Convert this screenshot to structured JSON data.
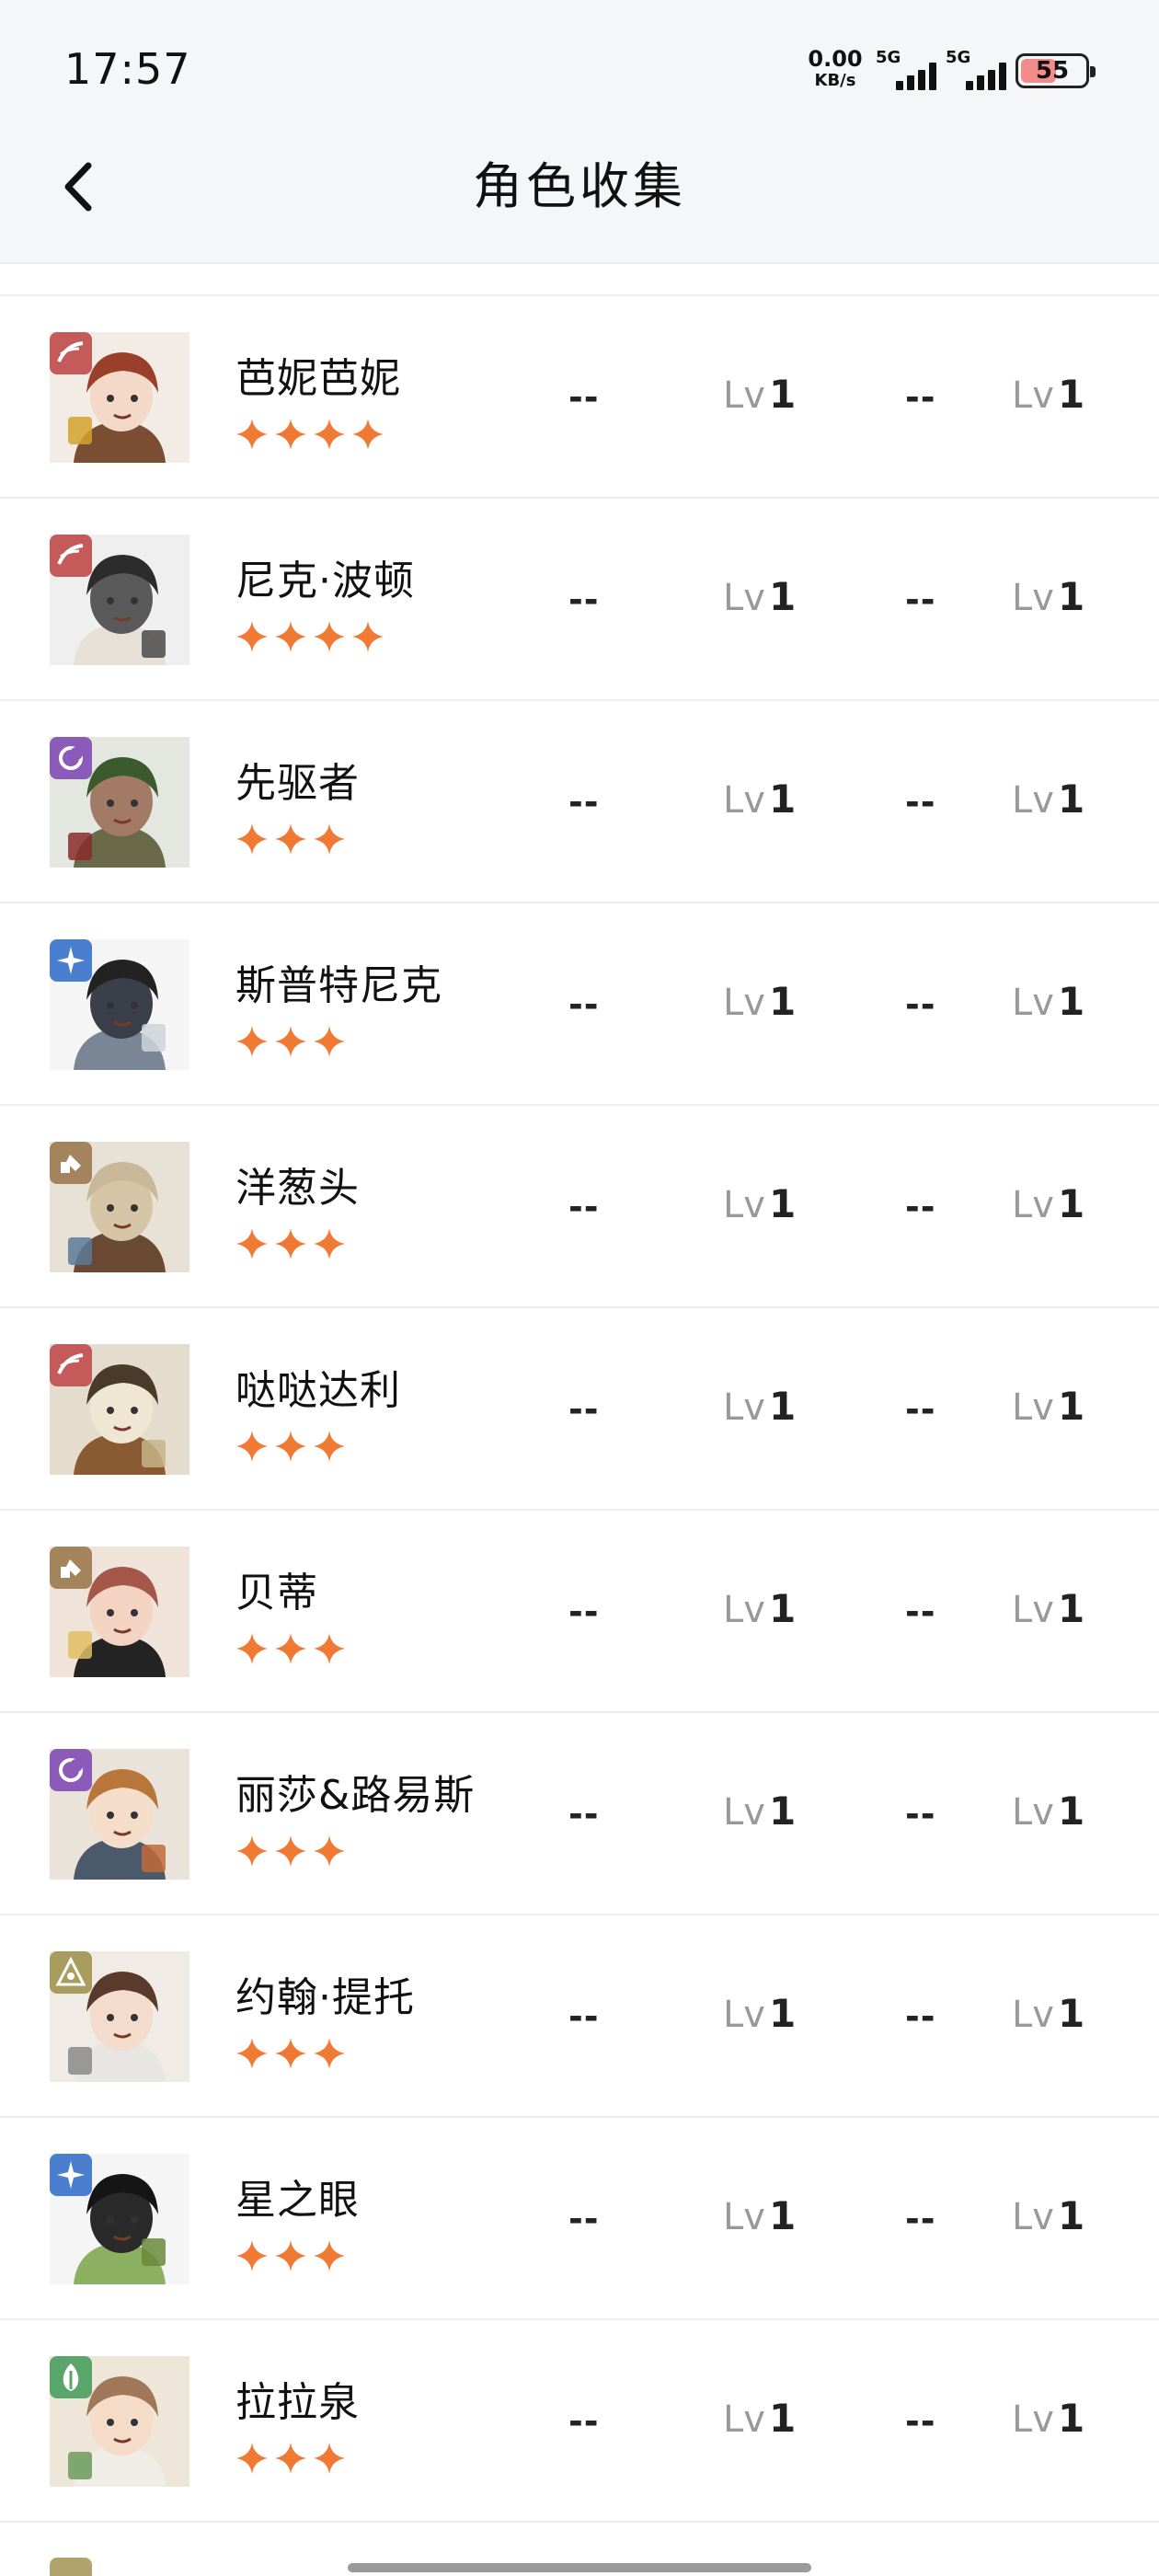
{
  "status_bar": {
    "time": "17:57",
    "net_speed_value": "0.00",
    "net_speed_unit": "KB/s",
    "signal1_label": "5G",
    "signal2_label": "5G",
    "battery": "55"
  },
  "header": {
    "title": "角色收集",
    "back_icon": "chevron-left-icon"
  },
  "colors": {
    "star": "#f07a33",
    "attr_red": "#c45a5a",
    "attr_purple": "#8a5bb8",
    "attr_blue": "#4a7fcf",
    "attr_tan": "#a4845c",
    "attr_olive": "#a89c5f",
    "attr_green": "#5aa66a"
  },
  "characters": [
    {
      "name": "芭妮芭妮",
      "rarity": 4,
      "badge": "red",
      "dash1": "--",
      "lv1_label": "Lv",
      "lv1_value": "1",
      "dash2": "--",
      "lv2_label": "Lv",
      "lv2_value": "1"
    },
    {
      "name": "尼克·波顿",
      "rarity": 4,
      "badge": "red",
      "dash1": "--",
      "lv1_label": "Lv",
      "lv1_value": "1",
      "dash2": "--",
      "lv2_label": "Lv",
      "lv2_value": "1"
    },
    {
      "name": "先驱者",
      "rarity": 3,
      "badge": "purple",
      "dash1": "--",
      "lv1_label": "Lv",
      "lv1_value": "1",
      "dash2": "--",
      "lv2_label": "Lv",
      "lv2_value": "1"
    },
    {
      "name": "斯普特尼克",
      "rarity": 3,
      "badge": "blue",
      "dash1": "--",
      "lv1_label": "Lv",
      "lv1_value": "1",
      "dash2": "--",
      "lv2_label": "Lv",
      "lv2_value": "1"
    },
    {
      "name": "洋葱头",
      "rarity": 3,
      "badge": "tan",
      "dash1": "--",
      "lv1_label": "Lv",
      "lv1_value": "1",
      "dash2": "--",
      "lv2_label": "Lv",
      "lv2_value": "1"
    },
    {
      "name": "哒哒达利",
      "rarity": 3,
      "badge": "red",
      "dash1": "--",
      "lv1_label": "Lv",
      "lv1_value": "1",
      "dash2": "--",
      "lv2_label": "Lv",
      "lv2_value": "1"
    },
    {
      "name": "贝蒂",
      "rarity": 3,
      "badge": "tan",
      "dash1": "--",
      "lv1_label": "Lv",
      "lv1_value": "1",
      "dash2": "--",
      "lv2_label": "Lv",
      "lv2_value": "1"
    },
    {
      "name": "丽莎&路易斯",
      "rarity": 3,
      "badge": "purple",
      "dash1": "--",
      "lv1_label": "Lv",
      "lv1_value": "1",
      "dash2": "--",
      "lv2_label": "Lv",
      "lv2_value": "1"
    },
    {
      "name": "约翰·提托",
      "rarity": 3,
      "badge": "olive",
      "dash1": "--",
      "lv1_label": "Lv",
      "lv1_value": "1",
      "dash2": "--",
      "lv2_label": "Lv",
      "lv2_value": "1"
    },
    {
      "name": "星之眼",
      "rarity": 3,
      "badge": "blue",
      "dash1": "--",
      "lv1_label": "Lv",
      "lv1_value": "1",
      "dash2": "--",
      "lv2_label": "Lv",
      "lv2_value": "1"
    },
    {
      "name": "拉拉泉",
      "rarity": 3,
      "badge": "green",
      "dash1": "--",
      "lv1_label": "Lv",
      "lv1_value": "1",
      "dash2": "--",
      "lv2_label": "Lv",
      "lv2_value": "1"
    }
  ]
}
